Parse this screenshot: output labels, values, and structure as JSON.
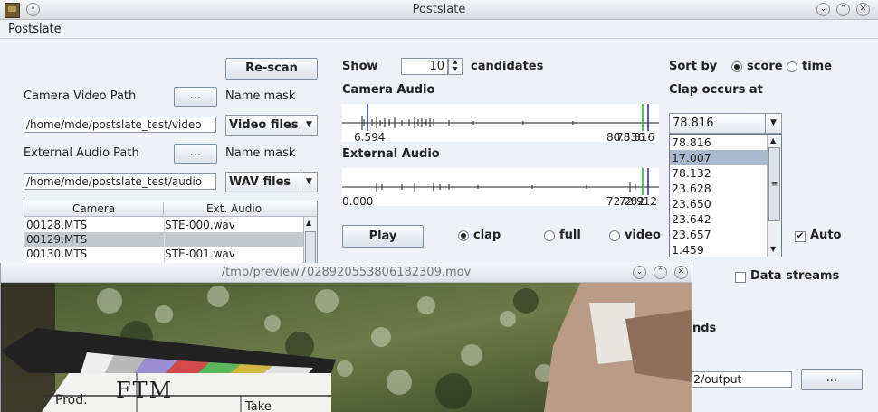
{
  "window": {
    "title": "Postslate"
  },
  "menu": {
    "label": "Postslate"
  },
  "rescan_label": "Re-scan",
  "camera": {
    "label": "Camera Video Path",
    "browse": "...",
    "mask_label": "Name mask",
    "path": "/home/mde/postslate_test/video",
    "mask": "Video files"
  },
  "external": {
    "label": "External Audio Path",
    "browse": "...",
    "mask_label": "Name mask",
    "path": "/home/mde/postslate_test/audio",
    "mask": "WAV files"
  },
  "table": {
    "headers": [
      "Camera",
      "Ext. Audio"
    ],
    "rows": [
      {
        "camera": "00128.MTS",
        "audio": "STE-000.wav"
      },
      {
        "camera": "00129.MTS",
        "audio": ""
      },
      {
        "camera": "00130.MTS",
        "audio": "STE-001.wav"
      }
    ]
  },
  "show": {
    "label": "Show",
    "value": "10",
    "suffix": "candidates"
  },
  "camera_audio": {
    "label": "Camera Audio",
    "start": "6.594",
    "end": "78.816",
    "end_overlap": "80.536"
  },
  "external_audio": {
    "label": "External Audio",
    "start": "0.000",
    "end": "72.282",
    "end_overlap": "72.912"
  },
  "play_label": "Play",
  "play_modes": [
    "clap",
    "full",
    "video"
  ],
  "sort": {
    "label": "Sort by",
    "options": [
      "score",
      "time"
    ]
  },
  "clap": {
    "label": "Clap occurs at",
    "selected": "78.816",
    "items": [
      "78.816",
      "17.007",
      "78.132",
      "23.628",
      "23.650",
      "23.642",
      "23.657",
      "1.459"
    ]
  },
  "auto_label": "Auto",
  "data_streams_label": "Data streams",
  "partial_label": "nds",
  "output_path": "2/output",
  "output_browse": "...",
  "preview": {
    "title": "/tmp/preview7028920553806182309.mov",
    "slate_prod": "Prod.",
    "slate_title": "FTM",
    "slate_take": "Take"
  }
}
